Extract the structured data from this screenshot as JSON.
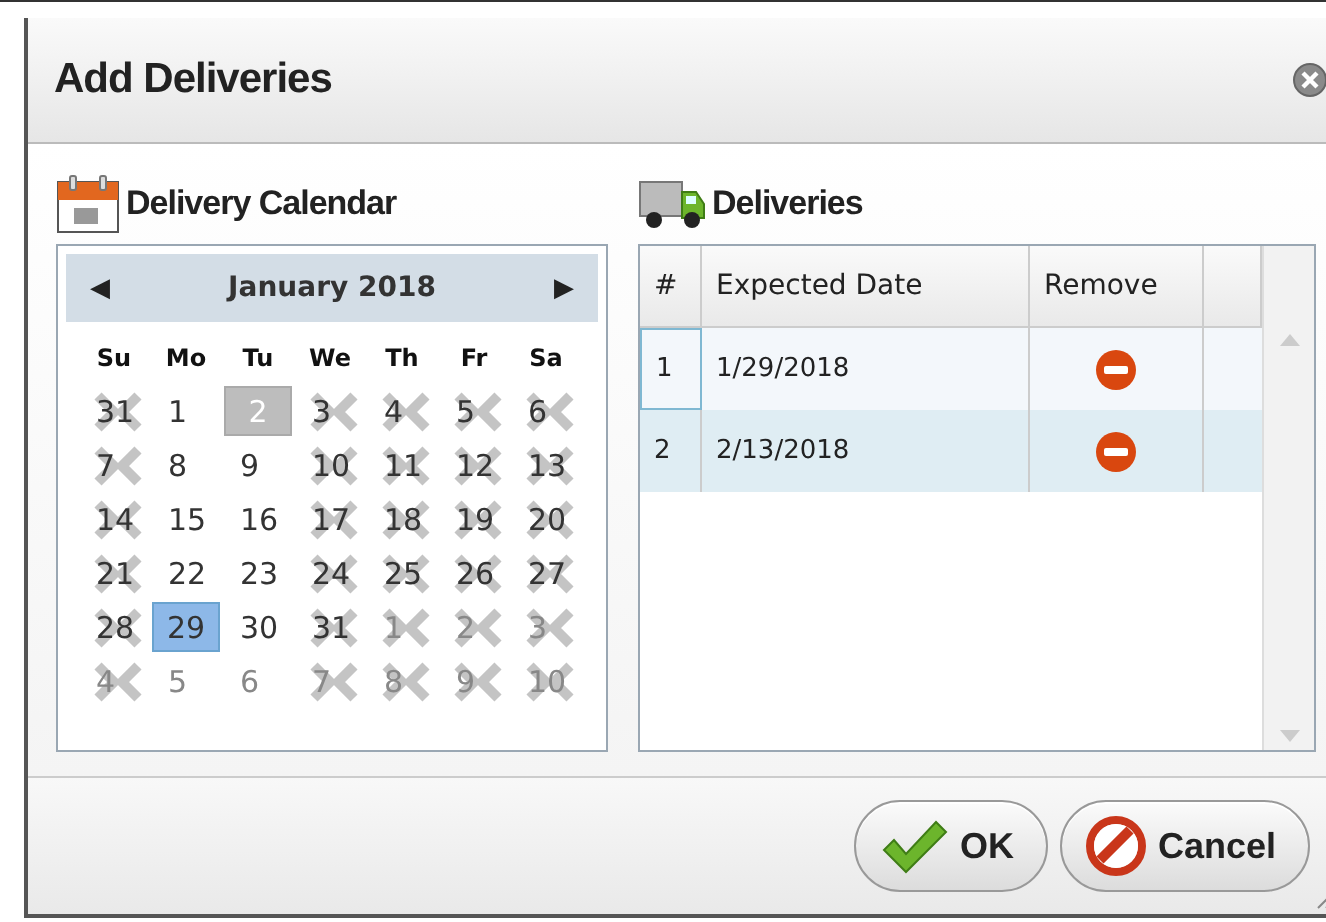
{
  "window": {
    "title": "Add Deliveries"
  },
  "calendar": {
    "heading": "Delivery Calendar",
    "month": "January 2018",
    "prev": "◀",
    "next": "▶",
    "weekdays": [
      "Su",
      "Mo",
      "Tu",
      "We",
      "Th",
      "Fr",
      "Sa"
    ],
    "weeks": [
      [
        {
          "day": "31",
          "blocked": true,
          "other_month": false,
          "selected": false,
          "today": false
        },
        {
          "day": "1",
          "blocked": false,
          "other_month": false,
          "selected": false,
          "today": false
        },
        {
          "day": "2",
          "blocked": false,
          "other_month": false,
          "selected": false,
          "today": true
        },
        {
          "day": "3",
          "blocked": true,
          "other_month": false,
          "selected": false,
          "today": false
        },
        {
          "day": "4",
          "blocked": true,
          "other_month": false,
          "selected": false,
          "today": false
        },
        {
          "day": "5",
          "blocked": true,
          "other_month": false,
          "selected": false,
          "today": false
        },
        {
          "day": "6",
          "blocked": true,
          "other_month": false,
          "selected": false,
          "today": false
        }
      ],
      [
        {
          "day": "7",
          "blocked": true,
          "other_month": false,
          "selected": false,
          "today": false
        },
        {
          "day": "8",
          "blocked": false,
          "other_month": false,
          "selected": false,
          "today": false
        },
        {
          "day": "9",
          "blocked": false,
          "other_month": false,
          "selected": false,
          "today": false
        },
        {
          "day": "10",
          "blocked": true,
          "other_month": false,
          "selected": false,
          "today": false
        },
        {
          "day": "11",
          "blocked": true,
          "other_month": false,
          "selected": false,
          "today": false
        },
        {
          "day": "12",
          "blocked": true,
          "other_month": false,
          "selected": false,
          "today": false
        },
        {
          "day": "13",
          "blocked": true,
          "other_month": false,
          "selected": false,
          "today": false
        }
      ],
      [
        {
          "day": "14",
          "blocked": true,
          "other_month": false,
          "selected": false,
          "today": false
        },
        {
          "day": "15",
          "blocked": false,
          "other_month": false,
          "selected": false,
          "today": false
        },
        {
          "day": "16",
          "blocked": false,
          "other_month": false,
          "selected": false,
          "today": false
        },
        {
          "day": "17",
          "blocked": true,
          "other_month": false,
          "selected": false,
          "today": false
        },
        {
          "day": "18",
          "blocked": true,
          "other_month": false,
          "selected": false,
          "today": false
        },
        {
          "day": "19",
          "blocked": true,
          "other_month": false,
          "selected": false,
          "today": false
        },
        {
          "day": "20",
          "blocked": true,
          "other_month": false,
          "selected": false,
          "today": false
        }
      ],
      [
        {
          "day": "21",
          "blocked": true,
          "other_month": false,
          "selected": false,
          "today": false
        },
        {
          "day": "22",
          "blocked": false,
          "other_month": false,
          "selected": false,
          "today": false
        },
        {
          "day": "23",
          "blocked": false,
          "other_month": false,
          "selected": false,
          "today": false
        },
        {
          "day": "24",
          "blocked": true,
          "other_month": false,
          "selected": false,
          "today": false
        },
        {
          "day": "25",
          "blocked": true,
          "other_month": false,
          "selected": false,
          "today": false
        },
        {
          "day": "26",
          "blocked": true,
          "other_month": false,
          "selected": false,
          "today": false
        },
        {
          "day": "27",
          "blocked": true,
          "other_month": false,
          "selected": false,
          "today": false
        }
      ],
      [
        {
          "day": "28",
          "blocked": true,
          "other_month": false,
          "selected": false,
          "today": false
        },
        {
          "day": "29",
          "blocked": false,
          "other_month": false,
          "selected": true,
          "today": false
        },
        {
          "day": "30",
          "blocked": false,
          "other_month": false,
          "selected": false,
          "today": false
        },
        {
          "day": "31",
          "blocked": true,
          "other_month": false,
          "selected": false,
          "today": false
        },
        {
          "day": "1",
          "blocked": true,
          "other_month": true,
          "selected": false,
          "today": false
        },
        {
          "day": "2",
          "blocked": true,
          "other_month": true,
          "selected": false,
          "today": false
        },
        {
          "day": "3",
          "blocked": true,
          "other_month": true,
          "selected": false,
          "today": false
        }
      ],
      [
        {
          "day": "4",
          "blocked": true,
          "other_month": true,
          "selected": false,
          "today": false
        },
        {
          "day": "5",
          "blocked": false,
          "other_month": true,
          "selected": false,
          "today": false
        },
        {
          "day": "6",
          "blocked": false,
          "other_month": true,
          "selected": false,
          "today": false
        },
        {
          "day": "7",
          "blocked": true,
          "other_month": true,
          "selected": false,
          "today": false
        },
        {
          "day": "8",
          "blocked": true,
          "other_month": true,
          "selected": false,
          "today": false
        },
        {
          "day": "9",
          "blocked": true,
          "other_month": true,
          "selected": false,
          "today": false
        },
        {
          "day": "10",
          "blocked": true,
          "other_month": true,
          "selected": false,
          "today": false
        }
      ]
    ]
  },
  "deliveries": {
    "heading": "Deliveries",
    "columns": [
      "#",
      "Expected Date",
      "Remove"
    ],
    "rows": [
      {
        "number": "1",
        "date": "1/29/2018",
        "focused": true
      },
      {
        "number": "2",
        "date": "2/13/2018",
        "focused": false
      }
    ]
  },
  "buttons": [
    {
      "kind": "ok",
      "label": "OK"
    },
    {
      "kind": "cancel",
      "label": "Cancel"
    }
  ]
}
